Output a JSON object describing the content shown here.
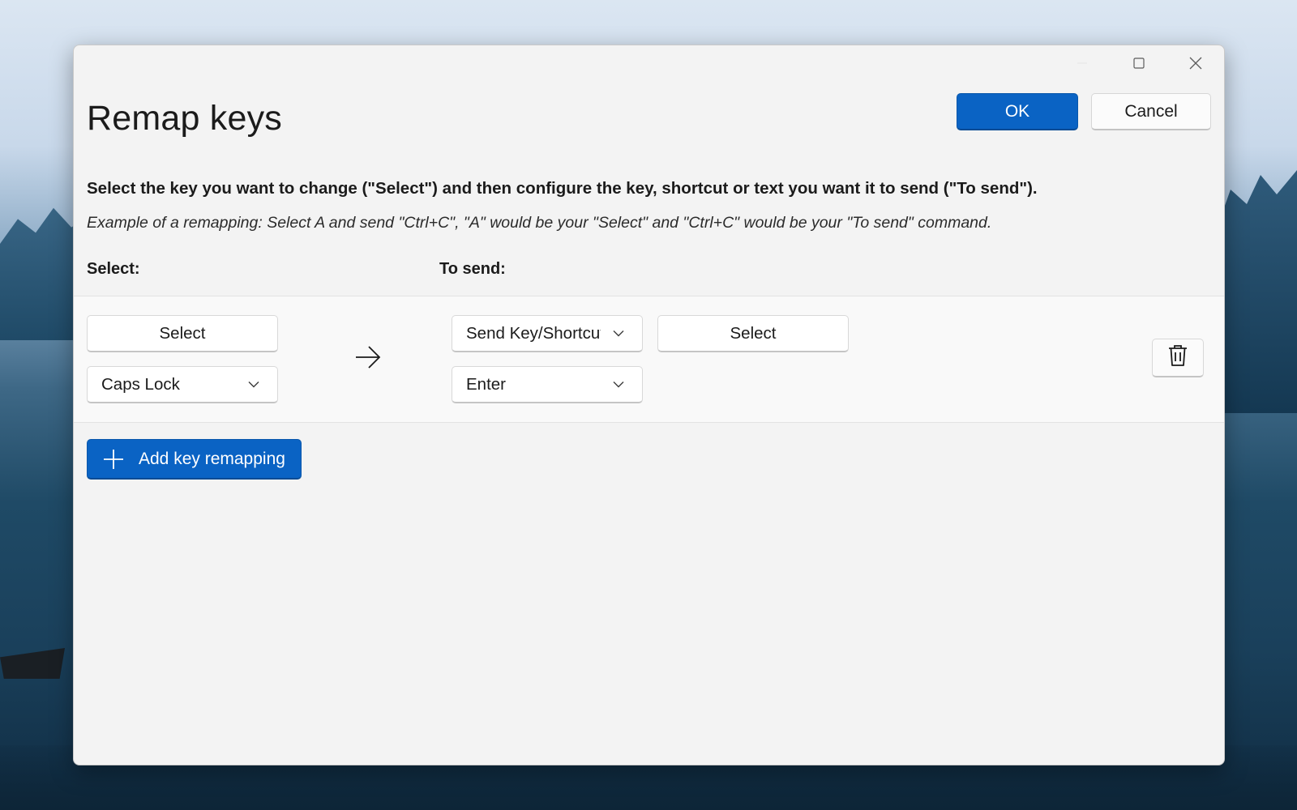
{
  "window": {
    "title": "Remap keys",
    "caption_icons": [
      "minimize-icon",
      "maximize-icon",
      "close-icon"
    ]
  },
  "actions": {
    "ok_label": "OK",
    "cancel_label": "Cancel"
  },
  "instructions": {
    "main": "Select the key you want to change (\"Select\") and then configure the key, shortcut or text you want it to send (\"To send\").",
    "example": "Example of a remapping: Select A and send \"Ctrl+C\", \"A\" would be your \"Select\" and \"Ctrl+C\" would be your \"To send\" command."
  },
  "columns": {
    "select_label": "Select:",
    "send_label": "To send:"
  },
  "mapping": {
    "select_button_label": "Select",
    "select_key_value": "Caps Lock",
    "send_type_value": "Send Key/Shortcut",
    "send_select_button_label": "Select",
    "send_key_value": "Enter",
    "arrow_icon": "arrow-right-icon",
    "delete_icon": "trash-icon"
  },
  "add_button": {
    "label": "Add key remapping",
    "icon": "plus-icon"
  },
  "colors": {
    "accent": "#0a63c4",
    "window_bg": "#f3f3f3",
    "row_bg": "#f9f9f9"
  }
}
